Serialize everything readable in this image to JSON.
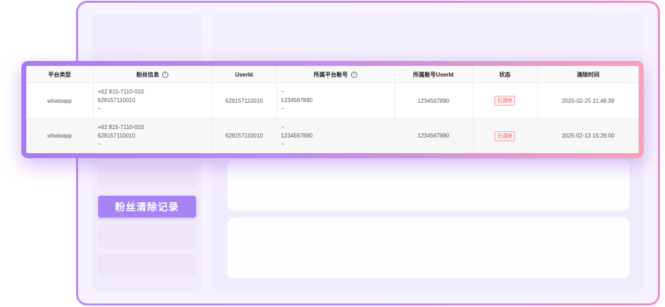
{
  "sidebar": {
    "primary_button": "粉丝清除记录"
  },
  "table": {
    "columns": [
      {
        "label": "平台类型",
        "has_info": false
      },
      {
        "label": "粉丝信息",
        "has_info": true
      },
      {
        "label": "UserId",
        "has_info": false
      },
      {
        "label": "所属平台账号",
        "has_info": true
      },
      {
        "label": "所属账号UserId",
        "has_info": false
      },
      {
        "label": "状态",
        "has_info": false
      },
      {
        "label": "清除时间",
        "has_info": false
      }
    ],
    "info_icon": "info-circle-icon",
    "rows": [
      {
        "platform": "whatsapp",
        "fan_info": [
          "+62 815-7110-010",
          "628157110010",
          "~"
        ],
        "user_id": "628157110010",
        "platform_account": [
          "~",
          "1234567890",
          "~"
        ],
        "account_user_id": "1234567890",
        "status": "已清除",
        "cleared_time": "2025-02-25 11:48:39"
      },
      {
        "platform": "whatsapp",
        "fan_info": [
          "+62 815-7110-010",
          "628157110010",
          "~"
        ],
        "user_id": "628157110010",
        "platform_account": [
          "~",
          "1234567890",
          "~"
        ],
        "account_user_id": "1234567890",
        "status": "已清除",
        "cleared_time": "2025-02-13 15:26:00"
      }
    ]
  },
  "colors": {
    "accent": "#a883f3",
    "frame_gradient_start": "#b48cf2",
    "frame_gradient_end": "#ee8ec8",
    "status_text": "#e35555"
  }
}
